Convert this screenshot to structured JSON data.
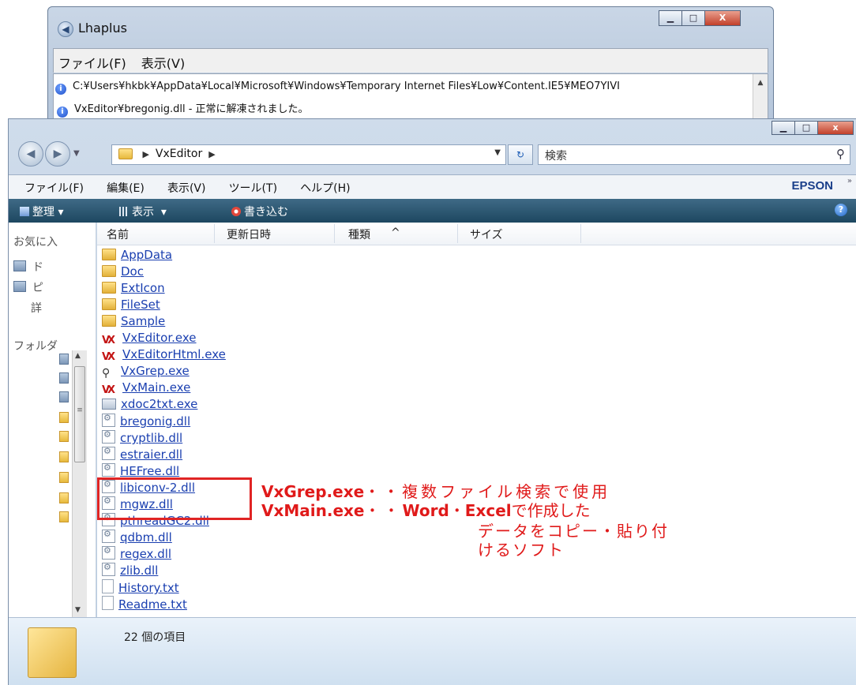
{
  "lhaplus": {
    "title": "Lhaplus",
    "menu": [
      "ファイル(F)",
      "表示(V)"
    ],
    "log": [
      "C:¥Users¥hkbk¥AppData¥Local¥Microsoft¥Windows¥Temporary Internet Files¥Low¥Content.IE5¥MEO7YIVI",
      "VxEditor¥bregonig.dll - 正常に解凍されました。"
    ]
  },
  "explorer": {
    "breadcrumb": "VxEditor",
    "search_placeholder": "検索",
    "menu": [
      "ファイル(F)",
      "編集(E)",
      "表示(V)",
      "ツール(T)",
      "ヘルプ(H)"
    ],
    "brand": "EPSON",
    "toolbar": [
      "整理",
      "表示",
      "書き込む"
    ],
    "navpane": [
      "お気に入",
      "ド",
      "ピ",
      "詳",
      "フォルダ"
    ],
    "columns": [
      "名前",
      "更新日時",
      "種類",
      "サイズ"
    ],
    "files": [
      {
        "name": "AppData",
        "icon": "folder-icon"
      },
      {
        "name": "Doc",
        "icon": "folder-icon"
      },
      {
        "name": "ExtIcon",
        "icon": "folder-icon"
      },
      {
        "name": "FileSet",
        "icon": "folder-icon"
      },
      {
        "name": "Sample",
        "icon": "folder-icon"
      },
      {
        "name": "VxEditor.exe",
        "icon": "vx-icon"
      },
      {
        "name": "VxEditorHtml.exe",
        "icon": "vx-icon"
      },
      {
        "name": "VxGrep.exe",
        "icon": "magnifier-icon"
      },
      {
        "name": "VxMain.exe",
        "icon": "vx-icon"
      },
      {
        "name": "xdoc2txt.exe",
        "icon": "exe-icon"
      },
      {
        "name": "bregonig.dll",
        "icon": "dll-icon"
      },
      {
        "name": "cryptlib.dll",
        "icon": "dll-icon"
      },
      {
        "name": "estraier.dll",
        "icon": "dll-icon"
      },
      {
        "name": "HEFree.dll",
        "icon": "dll-icon"
      },
      {
        "name": "libiconv-2.dll",
        "icon": "dll-icon"
      },
      {
        "name": "mgwz.dll",
        "icon": "dll-icon"
      },
      {
        "name": "pthreadGC2.dll",
        "icon": "dll-icon"
      },
      {
        "name": "qdbm.dll",
        "icon": "dll-icon"
      },
      {
        "name": "regex.dll",
        "icon": "dll-icon"
      },
      {
        "name": "zlib.dll",
        "icon": "dll-icon"
      },
      {
        "name": "History.txt",
        "icon": "text-file-icon"
      },
      {
        "name": "Readme.txt",
        "icon": "text-file-icon"
      }
    ],
    "status": "22 個の項目"
  },
  "annotation": {
    "grep_label": "VxGrep.exe",
    "grep_desc": "・・複数ファイル検索で使用",
    "main_label": "VxMain.exe",
    "main_desc_1": "・・",
    "main_word": "Word",
    "main_dot": "・",
    "main_excel": "Excel",
    "main_desc_2": "で作成した",
    "main_desc_3": "データをコピー・貼り付",
    "main_desc_4": "けるソフト",
    "color": "#e01a1a"
  }
}
